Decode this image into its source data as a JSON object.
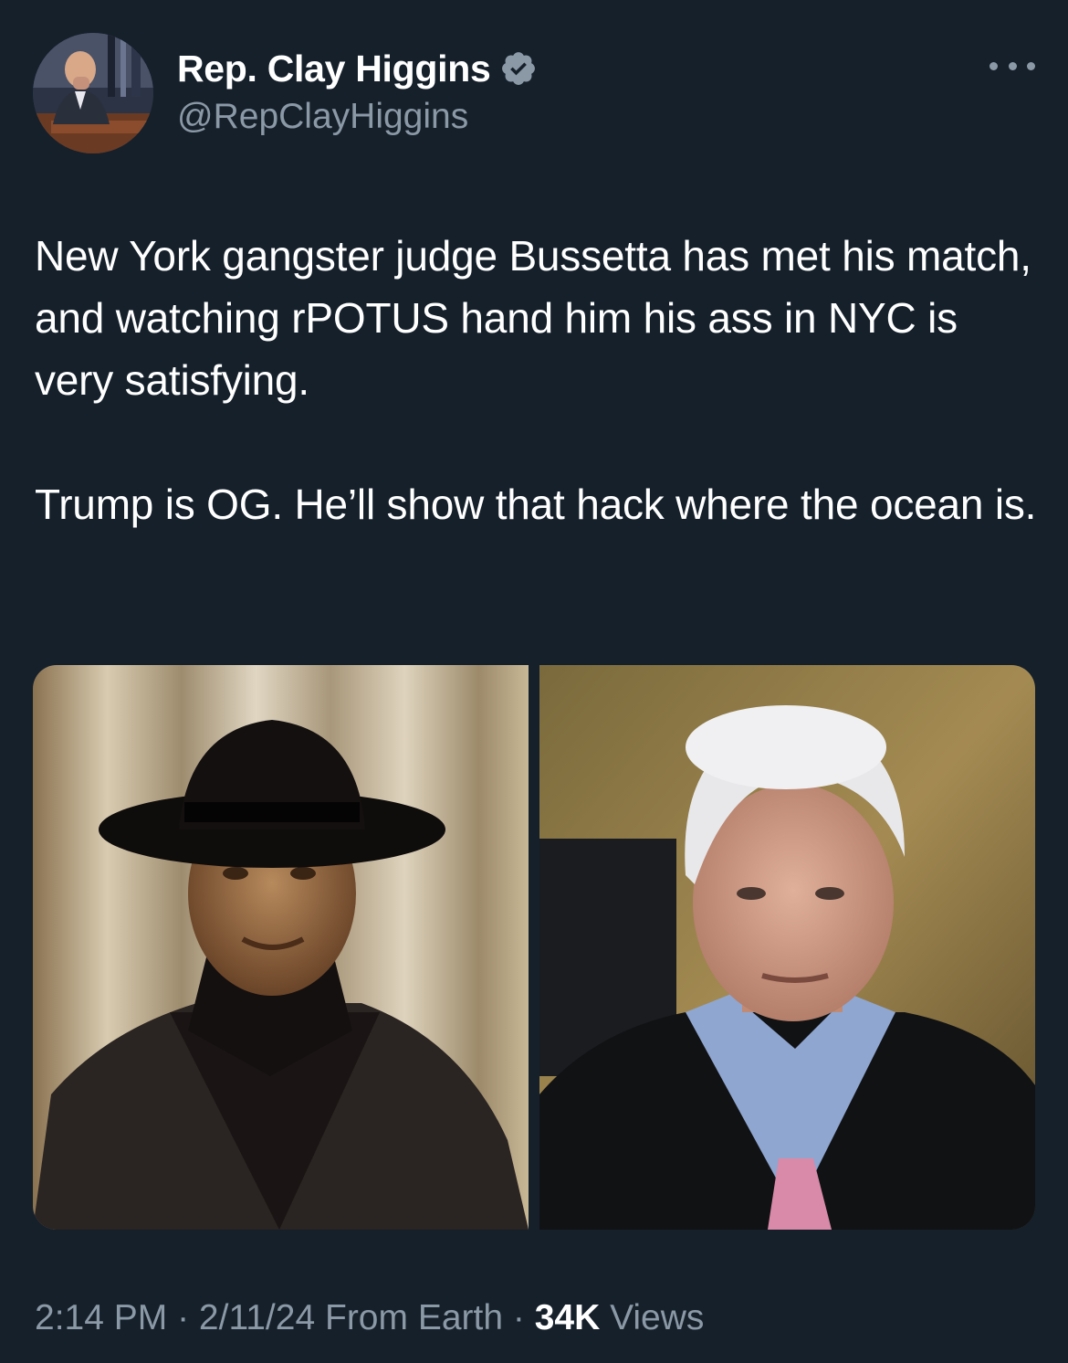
{
  "author": {
    "display_name": "Rep. Clay Higgins",
    "handle": "@RepClayHiggins",
    "verified": true,
    "avatar_icon": "profile-photo"
  },
  "tweet": {
    "paragraphs": [
      "New York gangster judge Bussetta has met his match, and watching rPOTUS hand him his ass in NYC is very satisfying.",
      "Trump is OG. He’ll show that hack where the ocean is."
    ],
    "media": [
      {
        "icon": "photo-man-in-black-fedora"
      },
      {
        "icon": "photo-white-haired-judge"
      }
    ]
  },
  "meta": {
    "time": "2:14 PM",
    "sep1": " · ",
    "date": "2/11/24",
    "source": " From Earth",
    "sep2": " · ",
    "views_count": "34K",
    "views_label": " Views"
  },
  "colors": {
    "background": "#15202b",
    "primary_text": "#ffffff",
    "secondary_text": "#8b98a5",
    "verified_badge": "#8b98a5"
  }
}
